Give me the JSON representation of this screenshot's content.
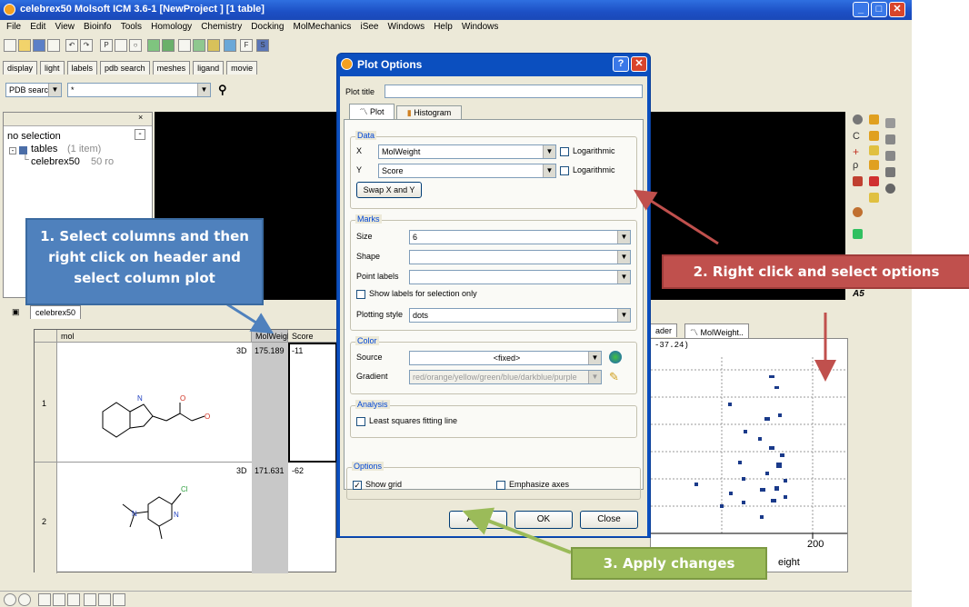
{
  "window": {
    "title": "celebrex50 Molsoft ICM 3.6-1 [NewProject ] [1 table]"
  },
  "menu": [
    "File",
    "Edit",
    "View",
    "Bioinfo",
    "Tools",
    "Homology",
    "Chemistry",
    "Docking",
    "MolMechanics",
    "iSee",
    "Windows",
    "Help",
    "Windows"
  ],
  "view_tabs": [
    "display",
    "light",
    "labels",
    "pdb search",
    "meshes",
    "ligand",
    "movie"
  ],
  "search": {
    "mode": "PDB search",
    "query": "*"
  },
  "tree": {
    "header": "no selection",
    "root_label": "tables",
    "root_count": "(1 item)",
    "child_label": "celebrex50",
    "child_info": "50 ro"
  },
  "table": {
    "tab": "celebrex50",
    "columns": [
      "mol",
      "MolWeight",
      "Score"
    ],
    "rows": [
      {
        "index": "1",
        "badge": "3D",
        "molweight": "175.189",
        "score": "-11"
      },
      {
        "index": "2",
        "badge": "3D",
        "molweight": "171.631",
        "score": "-62"
      }
    ]
  },
  "plot_panel": {
    "tab_left": "ader",
    "tab_right": "MolWeight..",
    "coord": "-37.24)",
    "xtick": "200",
    "xlabel": "eight"
  },
  "right_icon_text": "A5",
  "dialog": {
    "title": "Plot Options",
    "plot_title_label": "Plot title",
    "plot_title_value": "",
    "tabs": [
      "Plot",
      "Histogram"
    ],
    "data": {
      "legend": "Data",
      "x_label": "X",
      "x_value": "MolWeight",
      "y_label": "Y",
      "y_value": "Score",
      "log_label": "Logarithmic",
      "swap_label": "Swap X and Y"
    },
    "marks": {
      "legend": "Marks",
      "size_label": "Size",
      "size_value": "6",
      "shape_label": "Shape",
      "point_labels_label": "Point labels",
      "show_labels_label": "Show labels for selection only",
      "plotting_style_label": "Plotting style",
      "plotting_style_value": "dots"
    },
    "color": {
      "legend": "Color",
      "source_label": "Source",
      "source_value": "<fixed>",
      "gradient_label": "Gradient",
      "gradient_value": "red/orange/yellow/green/blue/darkblue/purple"
    },
    "analysis": {
      "legend": "Analysis",
      "least_squares_label": "Least squares fitting line"
    },
    "options": {
      "legend": "Options",
      "show_grid_label": "Show grid",
      "show_grid_checked": true,
      "emphasize_axes_label": "Emphasize axes"
    },
    "buttons": {
      "apply": "Apply",
      "ok": "OK",
      "close": "Close"
    }
  },
  "callouts": {
    "step1": "1. Select columns and then right click on header and select column plot",
    "step2": "2. Right click and select options",
    "step3": "3. Apply changes"
  },
  "colors": {
    "callout_blue": "#4f81bd",
    "callout_red": "#c0504d",
    "callout_green": "#9bbb59",
    "dialog_blue": "#0b4fbf"
  }
}
